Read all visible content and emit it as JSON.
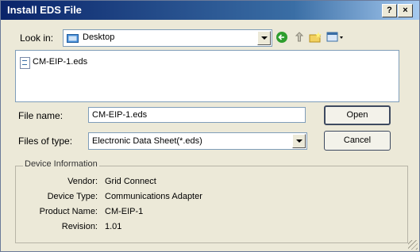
{
  "window": {
    "title": "Install EDS File",
    "help_btn": "?",
    "close_btn": "×"
  },
  "lookin": {
    "label": "Look in:",
    "value": "Desktop"
  },
  "toolbar": {
    "icons": [
      "back-icon",
      "up-folder-icon",
      "new-folder-icon",
      "view-menu-icon"
    ]
  },
  "files": [
    {
      "name": "CM-EIP-1.eds"
    }
  ],
  "filename": {
    "label": "File name:",
    "value": "CM-EIP-1.eds"
  },
  "filetype": {
    "label": "Files of type:",
    "value": "Electronic Data Sheet(*.eds)"
  },
  "buttons": {
    "open": "Open",
    "cancel": "Cancel"
  },
  "device_info": {
    "title": "Device Information",
    "rows": [
      {
        "label": "Vendor:",
        "value": "Grid Connect"
      },
      {
        "label": "Device Type:",
        "value": "Communications Adapter"
      },
      {
        "label": "Product Name:",
        "value": "CM-EIP-1"
      },
      {
        "label": "Revision:",
        "value": "1.01"
      }
    ]
  },
  "colors": {
    "title_bar": "#0a246a",
    "dialog_bg": "#ece9d8",
    "folder": "#4a90d9",
    "back_arrow": "#2e9e2e"
  }
}
